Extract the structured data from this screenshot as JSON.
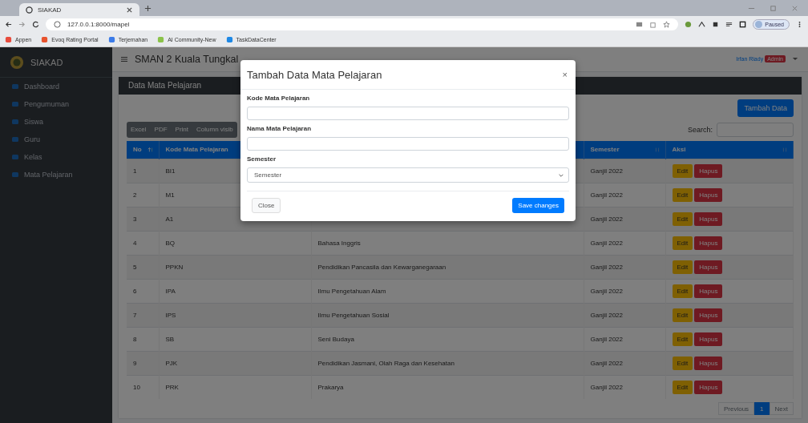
{
  "browser": {
    "tab_title": "SIAKAD",
    "address": "127.0.0.1:8000/mapel",
    "bookmarks": [
      "Appen",
      "Evoq Rating Portal",
      "Terjemahan",
      "AI Community-New",
      "TaskDataCenter"
    ],
    "profile": "Paused"
  },
  "sidebar": {
    "brand": "SIAKAD",
    "items": [
      {
        "label": "Dashboard",
        "selected": false
      },
      {
        "label": "Pengumuman",
        "selected": false
      },
      {
        "label": "Siswa",
        "selected": false
      },
      {
        "label": "Guru",
        "selected": false
      },
      {
        "label": "Kelas",
        "selected": false
      },
      {
        "label": "Mata Pelajaran",
        "selected": false
      }
    ]
  },
  "topbar": {
    "title": "SMAN 2 Kuala Tungkal",
    "user": "Irfan Riady",
    "role_badge": "Admin"
  },
  "card": {
    "title": "Data Mata Pelajaran",
    "add_button": "Tambah Data",
    "export_buttons": [
      "Excel",
      "PDF",
      "Print",
      "Column visib"
    ],
    "search_label": "Search:",
    "table": {
      "columns": [
        {
          "label": "No",
          "sorted": true
        },
        {
          "label": "Kode Mata Pelajaran"
        },
        {},
        {
          "label": "Semester",
          "sorted": false
        },
        {
          "label": "Aksi",
          "sorted": false
        }
      ],
      "rows": [
        {
          "no": "1",
          "kode": "BI1",
          "semester": "Ganjil 2022",
          "actions": [
            "Edit",
            "Hapus"
          ]
        },
        {
          "no": "2",
          "kode": "M1",
          "semester": "Ganjil 2022",
          "actions": [
            "Edit",
            "Hapus"
          ]
        },
        {
          "no": "3",
          "kode": "A1",
          "semester": "Ganjil 2022",
          "actions": [
            "Edit",
            "Hapus"
          ]
        },
        {
          "no": "4",
          "kode": "BQ",
          "nama": "Bahasa Inggris",
          "semester": "Ganjil 2022",
          "actions": [
            "Edit",
            "Hapus"
          ]
        },
        {
          "no": "5",
          "kode": "PPKN",
          "nama": "Pendidikan Pancasila dan Kewarganegaraan",
          "semester": "Ganjil 2022",
          "actions": [
            "Edit",
            "Hapus"
          ]
        },
        {
          "no": "6",
          "kode": "IPA",
          "nama": "Ilmu Pengetahuan Alam",
          "semester": "Ganjil 2022",
          "actions": [
            "Edit",
            "Hapus"
          ]
        },
        {
          "no": "7",
          "kode": "IPS",
          "nama": "Ilmu Pengetahuan Sosial",
          "semester": "Ganjil 2022",
          "actions": [
            "Edit",
            "Hapus"
          ]
        },
        {
          "no": "8",
          "kode": "SB",
          "nama": "Seni Budaya",
          "semester": "Ganjil 2022",
          "actions": [
            "Edit",
            "Hapus"
          ]
        },
        {
          "no": "9",
          "kode": "PJK",
          "nama": "Pendidikan Jasmani, Olah Raga dan Kesehatan",
          "semester": "Ganjil 2022",
          "actions": [
            "Edit",
            "Hapus"
          ]
        },
        {
          "no": "10",
          "kode": "PRK",
          "nama": "Prakarya",
          "semester": "Ganjil 2022",
          "actions": [
            "Edit",
            "Hapus"
          ]
        }
      ]
    },
    "pagination": [
      {
        "label": "Previous",
        "selected": false
      },
      {
        "label": "1",
        "selected": true
      },
      {
        "label": "Next",
        "selected": false
      }
    ]
  },
  "modal": {
    "title": "Tambah Data Mata Pelajaran",
    "close_symbol": "×",
    "fields": [
      {
        "label": "Kode Mata Pelajaran",
        "kind": "text"
      },
      {
        "label": "Nama Mata Pelajaran",
        "kind": "text"
      },
      {
        "label": "Semester",
        "kind": "select",
        "value": "Semester"
      }
    ],
    "buttons": [
      {
        "label": "Close",
        "kind": "secondary"
      },
      {
        "label": "Save changes",
        "kind": "primary"
      }
    ]
  }
}
